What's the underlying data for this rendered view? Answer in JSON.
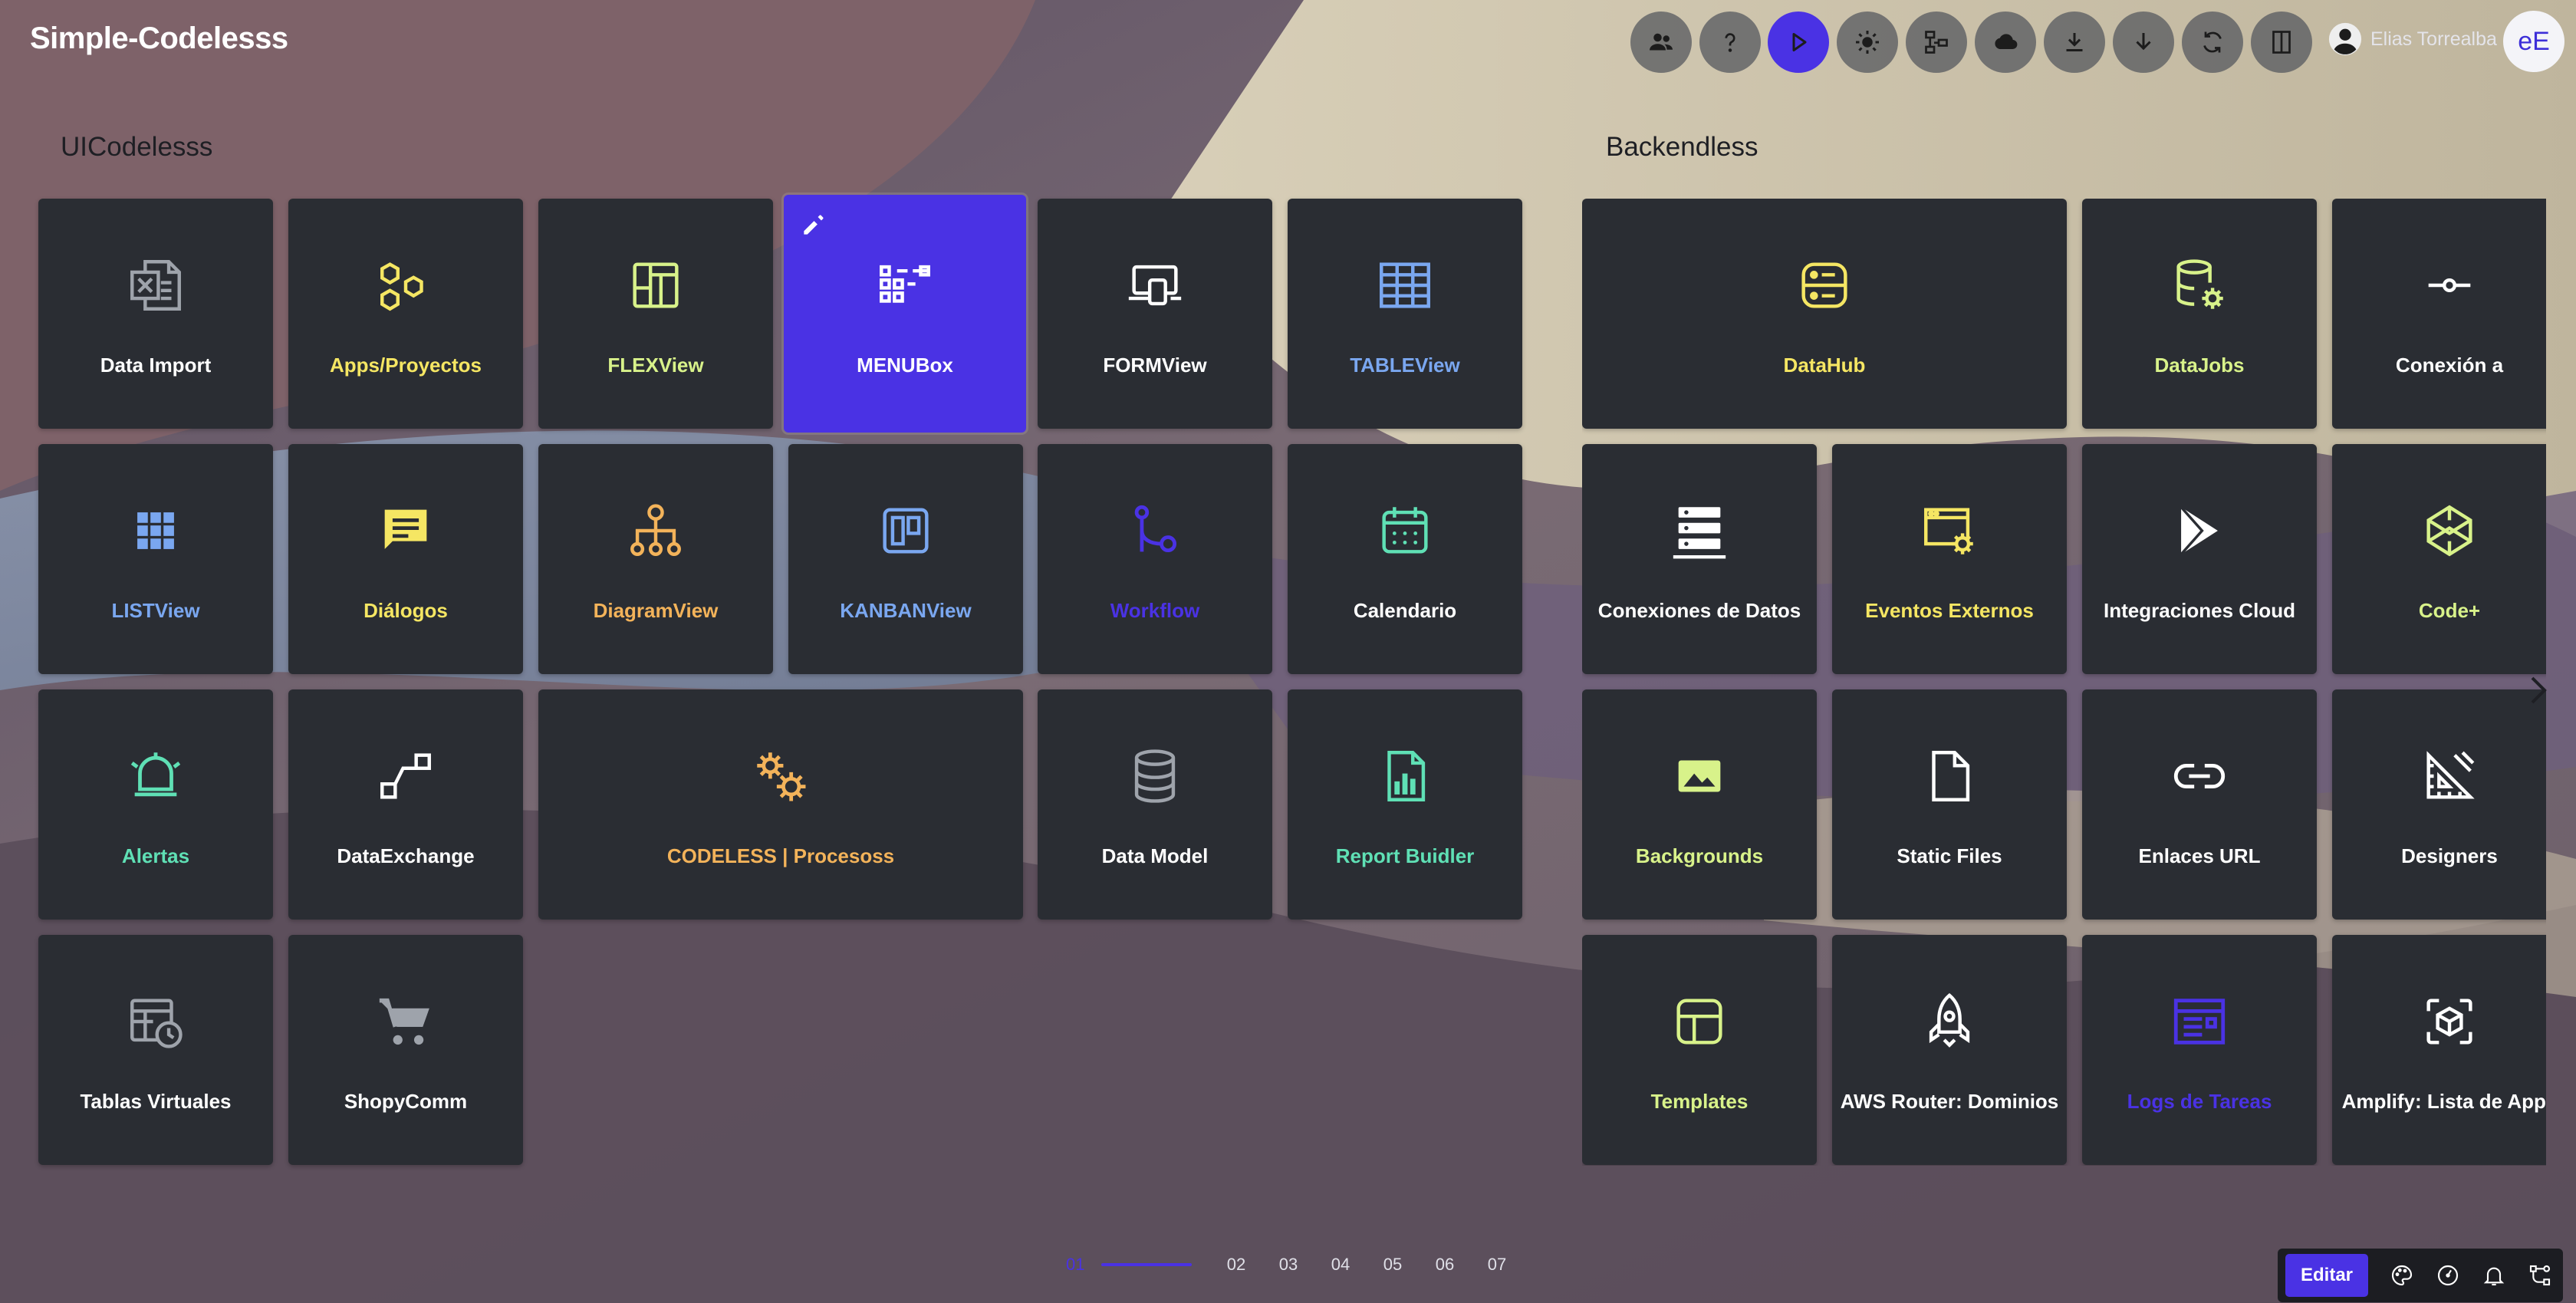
{
  "app": {
    "title": "Simple-Codelesss"
  },
  "header": {
    "user_name": "Elias Torrealba",
    "avatar_initials": "eE",
    "buttons": [
      {
        "icon": "people-icon"
      },
      {
        "icon": "help-icon"
      },
      {
        "icon": "play-icon",
        "active": true
      },
      {
        "icon": "brightness-icon"
      },
      {
        "icon": "flow-icon"
      },
      {
        "icon": "cloud-icon"
      },
      {
        "icon": "download-icon"
      },
      {
        "icon": "arrow-down-icon"
      },
      {
        "icon": "sync-icon"
      },
      {
        "icon": "exit-icon"
      }
    ]
  },
  "sections": {
    "left_title": "UICodelesss",
    "right_title": "Backendless"
  },
  "left_tiles": [
    {
      "label": "Data Import",
      "color": "#ffffff",
      "icon": "excel-icon"
    },
    {
      "label": "Apps/Proyectos",
      "color": "#f5e663",
      "icon": "hexagons-icon"
    },
    {
      "label": "FLEXView",
      "color": "#d8f28a",
      "icon": "layout-icon"
    },
    {
      "label": "MENUBox",
      "color": "#ffffff",
      "icon": "menu-grid-icon",
      "selected": true
    },
    {
      "label": "FORMView",
      "color": "#ffffff",
      "icon": "devices-icon"
    },
    {
      "label": "TABLEView",
      "color": "#7aa7f0",
      "icon": "table-icon"
    },
    {
      "label": "LISTView",
      "color": "#7aa7f0",
      "icon": "apps-grid-icon"
    },
    {
      "label": "Diálogos",
      "color": "#f5e663",
      "icon": "chat-icon"
    },
    {
      "label": "DiagramView",
      "color": "#f3b35a",
      "icon": "hierarchy-icon"
    },
    {
      "label": "KANBANView",
      "color": "#7aa7f0",
      "icon": "kanban-icon"
    },
    {
      "label": "Workflow",
      "color": "#4a32e4",
      "icon": "workflow-icon"
    },
    {
      "label": "Calendario",
      "color": "#ffffff",
      "icon": "calendar-icon"
    },
    {
      "label": "Alertas",
      "color": "#5fe0b5",
      "icon": "alarm-icon"
    },
    {
      "label": "DataExchange",
      "color": "#ffffff",
      "icon": "exchange-icon"
    },
    {
      "label": "CODELESS | Procesoss",
      "color": "#f3b35a",
      "icon": "gears-icon"
    },
    {
      "label": "Data Model",
      "color": "#ffffff",
      "icon": "database-icon"
    },
    {
      "label": "Report Buidler",
      "color": "#5fe0b5",
      "icon": "report-icon"
    },
    {
      "label": "Tablas Virtuales",
      "color": "#ffffff",
      "icon": "table-clock-icon"
    },
    {
      "label": "ShopyComm",
      "color": "#ffffff",
      "icon": "cart-icon"
    }
  ],
  "right_tiles": [
    {
      "label": "DataHub",
      "color": "#f5e663",
      "icon": "datahub-icon"
    },
    {
      "label": "DataJobs",
      "color": "#d8f28a",
      "icon": "db-gear-icon"
    },
    {
      "label": "Conexión a",
      "color": "#ffffff",
      "icon": "connection-icon"
    },
    {
      "label": "Conexiones de Datos",
      "color": "#ffffff",
      "icon": "servers-icon"
    },
    {
      "label": "Eventos Externos",
      "color": "#f5e663",
      "icon": "event-settings-icon"
    },
    {
      "label": "Integraciones Cloud",
      "color": "#ffffff",
      "icon": "play-store-icon"
    },
    {
      "label": "Code+",
      "color": "#d8f28a",
      "icon": "codepen-icon"
    },
    {
      "label": "Backgrounds",
      "color": "#d8f28a",
      "icon": "image-icon"
    },
    {
      "label": "Static Files",
      "color": "#ffffff",
      "icon": "file-icon"
    },
    {
      "label": "Enlaces URL",
      "color": "#ffffff",
      "icon": "link-icon"
    },
    {
      "label": "Designers",
      "color": "#ffffff",
      "icon": "ruler-icon"
    },
    {
      "label": "Templates",
      "color": "#d8f28a",
      "icon": "template-icon"
    },
    {
      "label": "AWS Router: Dominios",
      "color": "#ffffff",
      "icon": "rocket-icon"
    },
    {
      "label": "Logs de Tareas",
      "color": "#4a32e4",
      "icon": "logs-icon"
    },
    {
      "label": "Amplify: Lista de Apps",
      "color": "#ffffff",
      "icon": "cube-scan-icon"
    }
  ],
  "pager": {
    "current": "01",
    "pages": [
      "02",
      "03",
      "04",
      "05",
      "06",
      "07"
    ]
  },
  "bottom_bar": {
    "edit_label": "Editar",
    "icons": [
      "palette-icon",
      "speed-icon",
      "bell-icon",
      "nodes-icon"
    ]
  }
}
